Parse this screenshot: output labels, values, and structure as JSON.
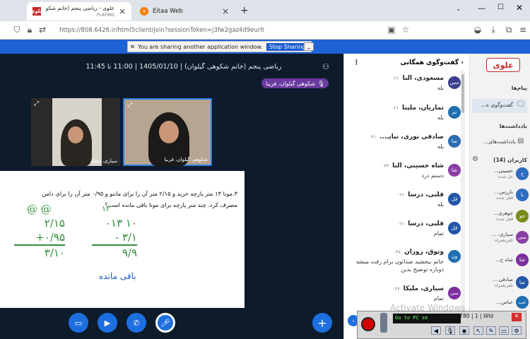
{
  "browser": {
    "tabs": [
      {
        "title": "علوی - ریاضی پنجم (خانم شکوه...",
        "sub": "PLAYING",
        "fav": "علوی"
      },
      {
        "title": "Eitaa Web",
        "fav": "e"
      }
    ],
    "url": "https://808.6426.ir/html5client/join?sessionToken=j3fw2gaz4d9eurlt"
  },
  "share": {
    "message": "You are sharing another application window.",
    "stop_label": "Stop Sharing",
    "min_label": "_"
  },
  "meeting": {
    "title": "ریاضی پنجم (خانم شکوهی گیلوان) | 1405/01/10 | 11:00 تا 11:45",
    "speaking": "شکوهی گیلوان، فریبا",
    "videos": [
      {
        "label": "سیاری، ملیک"
      },
      {
        "label": "شکوهی گیلوان، فریبا"
      }
    ]
  },
  "board": {
    "problem_line1": "۳.مونا ۱۳ متر پارچه خرید و ۲/۱۵ متر آن را برای مانتو و ۰/۹۵ متر آن را برای دامن",
    "problem_line2": "مصرف کرد. چند متر پارچه  برای مونا باقی مانده است؟",
    "left_calc": [
      "@ @",
      "۲/۱۵",
      "+۰/۹۵",
      "۳/۱۰"
    ],
    "right_calc": [
      "۱۲",
      "۰۱۳ ۱۰",
      "- ۳/۱",
      "۹/۹"
    ],
    "remain_label": "باقی مانده"
  },
  "chat": {
    "title": "گفت‌وگوی همگانی",
    "messages": [
      {
        "avatar": "مس",
        "name": "مسعودی، النا",
        "time": "۰۲۱",
        "text": "بله",
        "color": "#3d3f8f"
      },
      {
        "avatar": "نم",
        "name": "نماریان، ملینا",
        "time": "۰۲۱",
        "text": "بله",
        "color": "#1e6fb0"
      },
      {
        "avatar": "صا",
        "name": "صادقی نوری، نیایـ...",
        "time": "۰۳۱",
        "text": "بله",
        "color": "#2b6cb0"
      },
      {
        "avatar": "شا",
        "name": "شاه حسینی، النا",
        "time": "۰۳۳",
        "text": "دستم درد",
        "color": "#8a3fa3"
      },
      {
        "avatar": "قل",
        "name": "قلبی، درسا",
        "time": "۰۲۶",
        "text": "بله",
        "color": "#2456a8"
      },
      {
        "avatar": "قل",
        "name": "قلبی، درسا",
        "time": "۰۲۶",
        "text": "تمام",
        "color": "#2456a8"
      },
      {
        "avatar": "ون",
        "name": "ونوق، روزان",
        "time": "۰۳۷",
        "text": "خانم ببخشید صداتون برام رفت میشه دوباره توضیح بدین",
        "color": "#1f6fb2"
      },
      {
        "avatar": "سی",
        "name": "سیاری، ملیکا",
        "time": "۰۴۷",
        "text": "تمام",
        "color": "#7b2f9e"
      }
    ]
  },
  "sidebar": {
    "logo": "علوی",
    "messages_label": "پیام‌ها",
    "public_chat": "گفت‌وگوی ه...",
    "notes_label": "یادداشت‌ها",
    "shared_notes": "یادداشت‌های...",
    "users_label": "کاربران (14)",
    "users": [
      {
        "avatar": "ح",
        "name": "حسینی...",
        "status": "غل شده",
        "color": "#2d6cc0"
      },
      {
        "avatar": "با",
        "name": "بازرس...",
        "status": "قفل شده",
        "color": "#2d6cc0"
      },
      {
        "avatar": "جو",
        "name": "جوهری...",
        "status": "قفل شده",
        "color": "#7b8b1a"
      },
      {
        "avatar": "سی",
        "name": "سیاری، ...",
        "status": "تلفن‌همراه",
        "color": "#8a3fa3"
      },
      {
        "avatar": "شا",
        "name": "شاه ح...",
        "status": "",
        "color": "#7b2f9e"
      },
      {
        "avatar": "صا",
        "name": "صادقی ...",
        "status": "تلفن‌همراه",
        "color": "#2456a8"
      },
      {
        "avatar": "عب",
        "name": "عباس...",
        "status": "",
        "color": "#1f6fb2"
      }
    ]
  },
  "recorder": {
    "watermark": "Activate Windows",
    "label": "Go to PC se",
    "readout": "1366 x 780 | 1 | Wid"
  }
}
